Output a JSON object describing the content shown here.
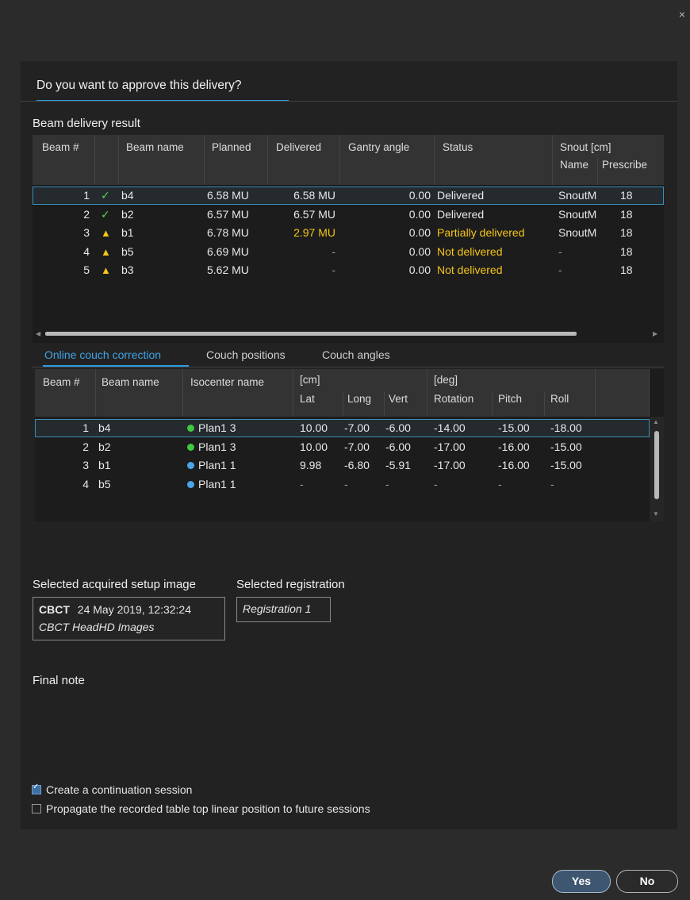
{
  "window": {
    "close_glyph": "×"
  },
  "dialog": {
    "title": "Do you want to approve this delivery?"
  },
  "beam_result": {
    "title": "Beam delivery result",
    "headers": {
      "beam_no": "Beam #",
      "beam_name": "Beam name",
      "planned": "Planned",
      "delivered": "Delivered",
      "gantry": "Gantry angle",
      "status": "Status",
      "snout": "Snout [cm]",
      "snout_name": "Name",
      "snout_prescribed": "Prescribe"
    },
    "rows": [
      {
        "no": "1",
        "icon": "✓",
        "icon_type": "check",
        "name": "b4",
        "planned": "6.58 MU",
        "delivered": "6.58 MU",
        "gantry": "0.00",
        "status": "Delivered",
        "status_type": "ok",
        "snout_name": "SnoutM",
        "snout_pres": "18"
      },
      {
        "no": "2",
        "icon": "✓",
        "icon_type": "check",
        "name": "b2",
        "planned": "6.57 MU",
        "delivered": "6.57 MU",
        "gantry": "0.00",
        "status": "Delivered",
        "status_type": "ok",
        "snout_name": "SnoutM",
        "snout_pres": "18"
      },
      {
        "no": "3",
        "icon": "▲",
        "icon_type": "warn",
        "name": "b1",
        "planned": "6.78 MU",
        "delivered": "2.97 MU",
        "gantry": "0.00",
        "status": "Partially delivered",
        "status_type": "warn",
        "snout_name": "SnoutM",
        "snout_pres": "18"
      },
      {
        "no": "4",
        "icon": "▲",
        "icon_type": "warn",
        "name": "b5",
        "planned": "6.69 MU",
        "delivered": "-",
        "gantry": "0.00",
        "status": "Not delivered",
        "status_type": "warn",
        "snout_name": "-",
        "snout_pres": "18"
      },
      {
        "no": "5",
        "icon": "▲",
        "icon_type": "warn",
        "name": "b3",
        "planned": "5.62 MU",
        "delivered": "-",
        "gantry": "0.00",
        "status": "Not delivered",
        "status_type": "warn",
        "snout_name": "-",
        "snout_pres": "18"
      }
    ]
  },
  "tabs": [
    {
      "label": "Online couch correction",
      "active": true
    },
    {
      "label": "Couch positions",
      "active": false
    },
    {
      "label": "Couch angles",
      "active": false
    }
  ],
  "couch": {
    "headers": {
      "beam_no": "Beam #",
      "beam_name": "Beam name",
      "isocenter": "Isocenter name",
      "cm": "[cm]",
      "lat": "Lat",
      "long": "Long",
      "vert": "Vert",
      "deg": "[deg]",
      "rotation": "Rotation",
      "pitch": "Pitch",
      "roll": "Roll"
    },
    "rows": [
      {
        "no": "1",
        "name": "b4",
        "iso": "Plan1 3",
        "dot": "#3ec93e",
        "lat": "10.00",
        "long": "-7.00",
        "vert": "-6.00",
        "rot": "-14.00",
        "pitch": "-15.00",
        "roll": "-18.00"
      },
      {
        "no": "2",
        "name": "b2",
        "iso": "Plan1 3",
        "dot": "#3ec93e",
        "lat": "10.00",
        "long": "-7.00",
        "vert": "-6.00",
        "rot": "-17.00",
        "pitch": "-16.00",
        "roll": "-15.00"
      },
      {
        "no": "3",
        "name": "b1",
        "iso": "Plan1 1",
        "dot": "#4aa6e8",
        "lat": "9.98",
        "long": "-6.80",
        "vert": "-5.91",
        "rot": "-17.00",
        "pitch": "-16.00",
        "roll": "-15.00"
      },
      {
        "no": "4",
        "name": "b5",
        "iso": "Plan1 1",
        "dot": "#4aa6e8",
        "lat": "-",
        "long": "-",
        "vert": "-",
        "rot": "-",
        "pitch": "-",
        "roll": "-"
      }
    ]
  },
  "setup_image": {
    "label": "Selected acquired setup image",
    "modality": "CBCT",
    "datetime": "24 May 2019, 12:32:24",
    "description": "CBCT HeadHD Images"
  },
  "registration": {
    "label": "Selected registration",
    "value": "Registration 1"
  },
  "final_note": {
    "label": "Final note"
  },
  "options": {
    "continuation": {
      "label": "Create a continuation session",
      "checked": true
    },
    "propagate": {
      "label": "Propagate the recorded table top linear position to future sessions",
      "checked": false
    }
  },
  "buttons": {
    "yes": "Yes",
    "no": "No"
  }
}
